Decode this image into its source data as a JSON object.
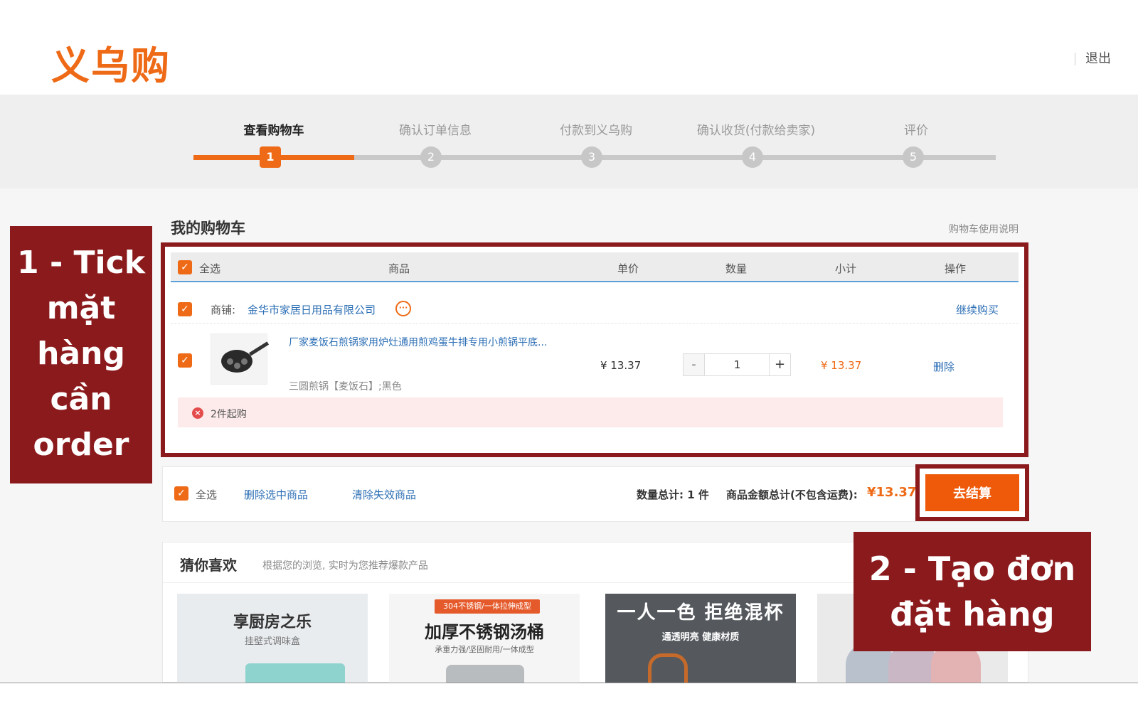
{
  "header": {
    "logo_text": "义乌购",
    "logout_label": "退出"
  },
  "steps": [
    {
      "label": "查看购物车",
      "number": "1",
      "active": true
    },
    {
      "label": "确认订单信息",
      "number": "2",
      "active": false
    },
    {
      "label": "付款到义乌购",
      "number": "3",
      "active": false
    },
    {
      "label": "确认收货(付款给卖家)",
      "number": "4",
      "active": false
    },
    {
      "label": "评价",
      "number": "5",
      "active": false
    }
  ],
  "cart": {
    "title": "我的购物车",
    "help_link": "购物车使用说明",
    "columns": {
      "select_all": "全选",
      "product": "商品",
      "unit_price": "单价",
      "quantity": "数量",
      "subtotal": "小计",
      "action": "操作"
    },
    "shop": {
      "label": "商铺:",
      "name": "金华市家居日用品有限公司",
      "continue_label": "继续购买",
      "chat_icon": "chat-bubble-icon"
    },
    "item": {
      "title": "厂家麦饭石煎锅家用炉灶通用煎鸡蛋牛排专用小煎锅平底...",
      "sku": "三圆煎锅【麦饭石】;黑色",
      "unit_price": "¥ 13.37",
      "quantity": "1",
      "minus_label": "-",
      "plus_label": "+",
      "subtotal": "¥ 13.37",
      "delete_label": "删除",
      "checked": true
    },
    "warning": {
      "text": "2件起购"
    }
  },
  "footer": {
    "select_all": "全选",
    "delete_selected": "删除选中商品",
    "clear_invalid": "清除失效商品",
    "total_qty": "数量总计: 1 件",
    "total_amount_label": "商品金额总计(不包含运费):",
    "total_amount": "¥13.37",
    "checkout_label": "去结算"
  },
  "recommend": {
    "title": "猜你喜欢",
    "subtitle": "根据您的浏览, 实时为您推荐爆款产品",
    "cards": [
      {
        "line1": "享厨房之乐",
        "line2": "挂壁式调味盒"
      },
      {
        "badge": "304不锈钢/一体拉伸成型",
        "line1": "加厚不锈钢汤桶",
        "line2": "承重力强/坚固耐用/一体成型"
      },
      {
        "line1": "一人一色 拒绝混杯",
        "line2": "通透明亮 健康材质"
      },
      {}
    ]
  },
  "annotations": {
    "step1": "1 - Tick mặt hàng cần order",
    "step2": "2 - Tạo đơn đặt hàng"
  },
  "colors": {
    "brand_orange": "#ee6a16",
    "annotation_red": "#8b1a1d",
    "link_blue": "#2c6fb5"
  }
}
